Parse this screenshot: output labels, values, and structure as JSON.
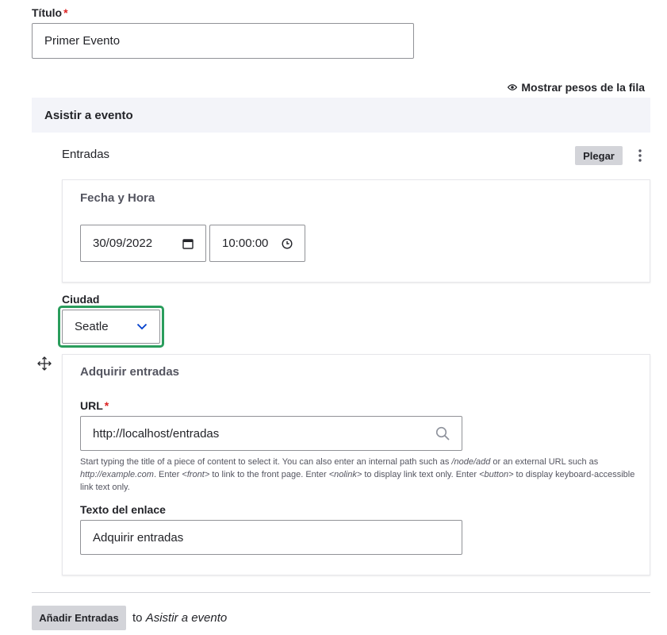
{
  "title_field": {
    "label": "Título",
    "required_mark": "*",
    "value": "Primer Evento"
  },
  "row_weights_toggle": {
    "label": "Mostrar pesos de la fila"
  },
  "section": {
    "title": "Asistir a evento"
  },
  "entries": {
    "label": "Entradas",
    "collapse_button": "Plegar",
    "datetime": {
      "title": "Fecha y Hora",
      "date": "30/09/2022",
      "time": "10:00:00"
    },
    "city": {
      "label": "Ciudad",
      "selected": "Seatle"
    },
    "acquire": {
      "title": "Adquirir entradas",
      "url_label": "URL",
      "url_required_mark": "*",
      "url_value": "http://localhost/entradas",
      "help_parts": {
        "p1": "Start typing the title of a piece of content to select it. You can also enter an internal path such as ",
        "e1": "/node/add",
        "p2": " or an external URL such as ",
        "e2": "http://example.com",
        "p3": ". Enter ",
        "e3": "<front>",
        "p4": " to link to the front page. Enter ",
        "e4": "<nolink>",
        "p5": " to display link text only. Enter ",
        "e5": "<button>",
        "p6": " to display keyboard-accessible link text only."
      },
      "link_text_label": "Texto del enlace",
      "link_text_value": "Adquirir entradas"
    }
  },
  "add_button": {
    "label": "Añadir Entradas",
    "suffix_to": "to",
    "suffix_target": "Asistir a evento"
  },
  "colors": {
    "focus_green": "#2a9d5c",
    "chevron_blue": "#003ecc",
    "section_bg": "#f3f4f9",
    "button_gray": "#d3d4d9"
  },
  "icons": [
    "eye-icon",
    "kebab-menu-icon",
    "calendar-icon",
    "clock-icon",
    "chevron-down-icon",
    "drag-handle-icon",
    "search-icon"
  ]
}
